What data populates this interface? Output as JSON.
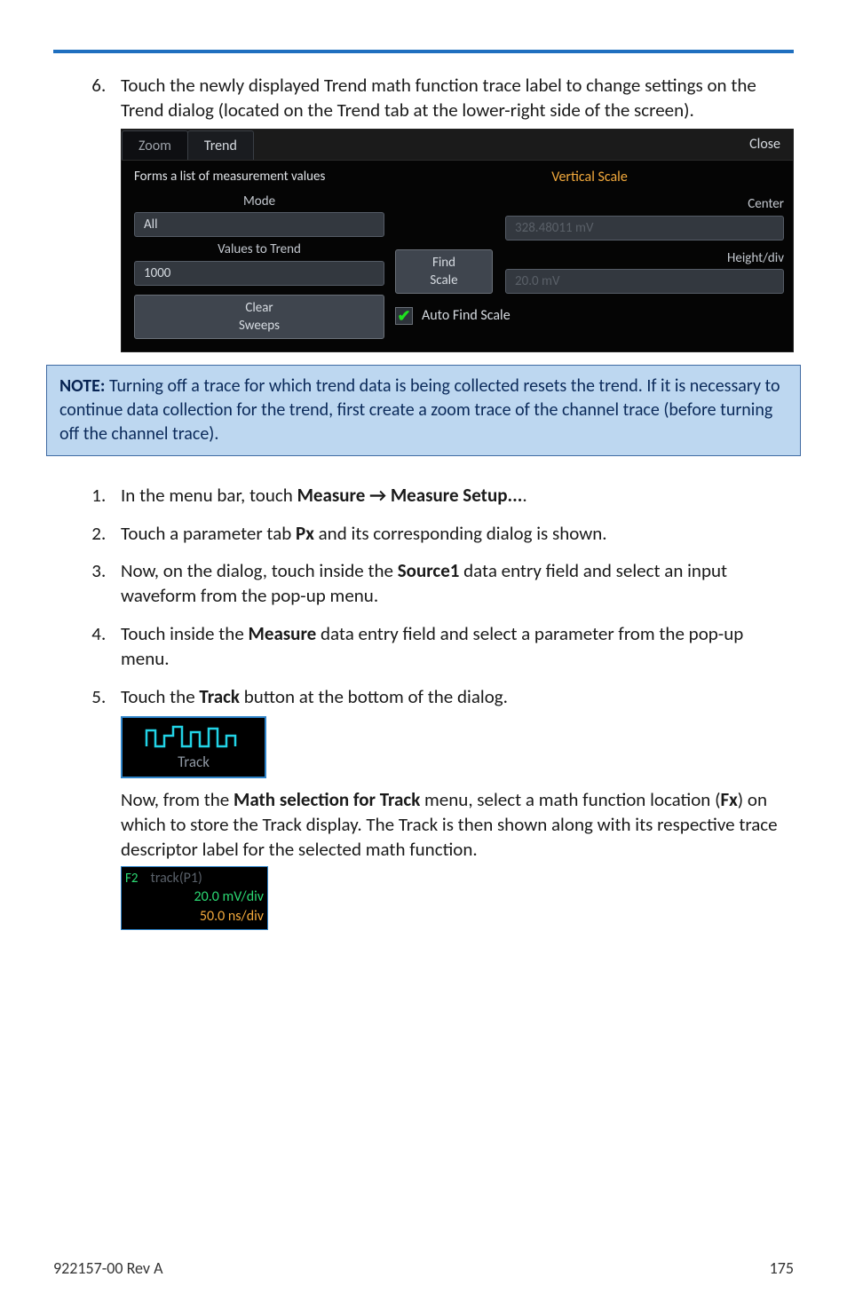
{
  "rule_color": "#1f6fbf",
  "intro_step": {
    "number": "6.",
    "text": "Touch the newly displayed Trend math function trace label to change settings on the Trend dialog (located on the Trend tab at the lower-right side of the screen)."
  },
  "dialog": {
    "tabs": {
      "zoom": "Zoom",
      "trend": "Trend"
    },
    "close": "Close",
    "description": "Forms a list of measurement values",
    "mode": {
      "label": "Mode",
      "value": "All"
    },
    "values_to_trend": {
      "label": "Values to Trend",
      "value": "1000"
    },
    "clear_sweeps": "Clear\nSweeps",
    "vertical_scale": {
      "title": "Vertical Scale",
      "center": {
        "label": "Center",
        "value": "328.48011 mV"
      },
      "find_scale": "Find\nScale",
      "height": {
        "label": "Height/div",
        "value": "20.0 mV"
      },
      "auto_find_scale": "Auto Find Scale"
    }
  },
  "note": {
    "prefix": "NOTE:",
    "body": " Turning off a trace for which trend data is being collected resets the trend. If it is necessary to continue data collection for the trend, first create a zoom trace of the channel trace (before turning off the channel trace)."
  },
  "steps": [
    {
      "parts": [
        "In the menu bar, touch ",
        "Measure → Measure Setup...",
        "."
      ]
    },
    {
      "parts": [
        "Touch a parameter tab ",
        "Px",
        " and its corresponding dialog is shown."
      ]
    },
    {
      "parts": [
        "Now, on the dialog, touch inside the ",
        "Source1",
        " data entry field and select an input waveform from the pop-up menu."
      ]
    },
    {
      "parts": [
        "Touch inside the ",
        "Measure",
        " data entry field and select a parameter from the pop-up menu."
      ]
    },
    {
      "parts": [
        "Touch the ",
        "Track",
        " button at the bottom of the dialog."
      ]
    }
  ],
  "track_button": {
    "label": "Track"
  },
  "after_track": {
    "parts": [
      "Now, from the ",
      "Math selection for Track",
      " menu, select a math function location (",
      "Fx",
      ") on which to store the Track display. The Track is then shown along with its respective trace descriptor label for the selected math function."
    ]
  },
  "trace_descriptor": {
    "badge": "F2",
    "name": "track(P1)",
    "line2": "20.0 mV/div",
    "line3": "50.0 ns/div"
  },
  "footer": {
    "left": "922157-00 Rev A",
    "right": "175"
  }
}
